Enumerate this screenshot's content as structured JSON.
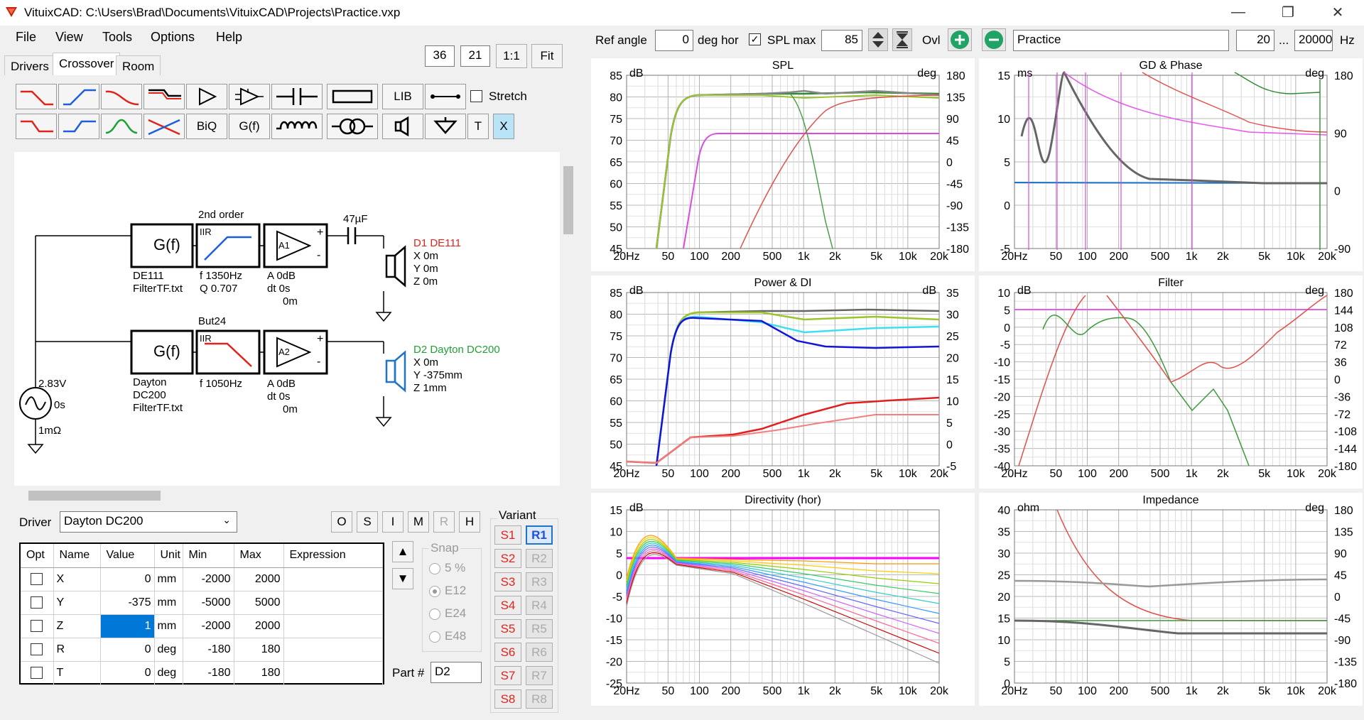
{
  "window": {
    "title": "VituixCAD: C:\\Users\\Brad\\Documents\\VituixCAD\\Projects\\Practice.vxp"
  },
  "menu": [
    "File",
    "View",
    "Tools",
    "Options",
    "Help"
  ],
  "tabs": [
    "Drivers",
    "Crossover",
    "Room"
  ],
  "toolbar_top": {
    "val1": "36",
    "val2": "21",
    "one_to_one": "1:1",
    "fit": "Fit"
  },
  "tools": {
    "lib": "LIB",
    "biq": "BiQ",
    "gf": "G(f)",
    "t": "T",
    "x": "X",
    "stretch": "Stretch"
  },
  "topbar": {
    "ref_angle_label": "Ref angle",
    "ref_angle": "0",
    "deg_hor": "deg hor",
    "spl_max_label": "SPL max",
    "spl_max": "85",
    "ovl": "Ovl",
    "project": "Practice",
    "f_min": "20",
    "dots": "...",
    "f_max": "20000",
    "hz": "Hz"
  },
  "schematic": {
    "block1": {
      "gf": "G(f)",
      "name": "DE111",
      "file": "FilterTF.txt",
      "order_label": "2nd order",
      "iir": "IIR",
      "f": "f   1350Hz",
      "q": "Q  0.707",
      "amp": "A1",
      "a": "A  0dB",
      "dt": "dt 0s",
      "dt2": "0m"
    },
    "block2": {
      "gf": "G(f)",
      "name1": "Dayton",
      "name2": "DC200",
      "file": "FilterTF.txt",
      "order_label": "But24",
      "iir": "IIR",
      "f": "f   1050Hz",
      "amp": "A2",
      "a": "A  0dB",
      "dt": "dt 0s",
      "dt2": "0m"
    },
    "cap": "47µF",
    "d1": {
      "label": "D1 DE111",
      "x": "X 0m",
      "y": "Y 0m",
      "z": "Z 0m"
    },
    "d2": {
      "label": "D2 Dayton DC200",
      "x": "X 0m",
      "y": "Y -375mm",
      "z": "Z 1mm"
    },
    "source": {
      "v": "2.83V",
      "t": "0s",
      "r": "1mΩ"
    }
  },
  "driver_panel": {
    "driver_label": "Driver",
    "driver_value": "Dayton DC200",
    "buttons": [
      "O",
      "S",
      "I",
      "M",
      "R",
      "H"
    ],
    "columns": [
      "Opt",
      "Name",
      "Value",
      "Unit",
      "Min",
      "Max",
      "Expression"
    ],
    "rows": [
      {
        "name": "X",
        "value": "0",
        "unit": "mm",
        "min": "-2000",
        "max": "2000"
      },
      {
        "name": "Y",
        "value": "-375",
        "unit": "mm",
        "min": "-5000",
        "max": "5000"
      },
      {
        "name": "Z",
        "value": "1",
        "unit": "mm",
        "min": "-2000",
        "max": "2000"
      },
      {
        "name": "R",
        "value": "0",
        "unit": "deg",
        "min": "-180",
        "max": "180"
      },
      {
        "name": "T",
        "value": "0",
        "unit": "deg",
        "min": "-180",
        "max": "180"
      }
    ],
    "snap_label": "Snap",
    "snap": [
      "5 %",
      "E12",
      "E24",
      "E48"
    ],
    "part_label": "Part #",
    "part_value": "D2",
    "variant_label": "Variant",
    "variants_s": [
      "S1",
      "S2",
      "S3",
      "S4",
      "S5",
      "S6",
      "S7",
      "S8"
    ],
    "variants_r": [
      "R1",
      "R2",
      "R3",
      "R4",
      "R5",
      "R6",
      "R7",
      "R8"
    ]
  },
  "charts": [
    {
      "title": "SPL",
      "lunit": "dB",
      "runit": "deg",
      "left": [
        "85",
        "80",
        "75",
        "70",
        "65",
        "60",
        "55",
        "50",
        "45"
      ],
      "right": [
        "180",
        "135",
        "90",
        "45",
        "0",
        "-45",
        "-90",
        "-135",
        "-180"
      ]
    },
    {
      "title": "GD & Phase",
      "lunit": "ms",
      "runit": "deg",
      "left": [
        "15",
        "10",
        "5",
        "0",
        "-5"
      ],
      "right": [
        "180",
        "90",
        "0",
        "-90"
      ]
    },
    {
      "title": "Power & DI",
      "lunit": "dB",
      "runit": "dB",
      "left": [
        "85",
        "80",
        "75",
        "70",
        "65",
        "60",
        "55",
        "50",
        "45"
      ],
      "right": [
        "35",
        "30",
        "25",
        "20",
        "15",
        "10",
        "5",
        "0",
        "-5"
      ]
    },
    {
      "title": "Filter",
      "lunit": "dB",
      "runit": "deg",
      "left": [
        "10",
        "5",
        "0",
        "-5",
        "-10",
        "-15",
        "-20",
        "-25",
        "-30",
        "-35",
        "-40"
      ],
      "right": [
        "180",
        "144",
        "108",
        "72",
        "36",
        "0",
        "-36",
        "-72",
        "-108",
        "-144",
        "-180"
      ]
    },
    {
      "title": "Directivity (hor)",
      "lunit": "dB",
      "runit": "",
      "left": [
        "15",
        "10",
        "5",
        "0",
        "-5",
        "-10",
        "-15",
        "-20",
        "-25"
      ],
      "right": []
    },
    {
      "title": "Impedance",
      "lunit": "ohm",
      "runit": "deg",
      "left": [
        "40",
        "35",
        "30",
        "25",
        "20",
        "15",
        "10",
        "5",
        "0"
      ],
      "right": [
        "180",
        "135",
        "90",
        "45",
        "0",
        "-45",
        "-90",
        "-135",
        "-180"
      ]
    }
  ],
  "freq_ticks": [
    "20Hz",
    "50",
    "100",
    "200",
    "500",
    "1k",
    "2k",
    "5k",
    "10k",
    "20k"
  ],
  "colors": {
    "accent_blue": "#1e74c8",
    "variant_red": "#e0241c",
    "add_green": "#21a366"
  }
}
